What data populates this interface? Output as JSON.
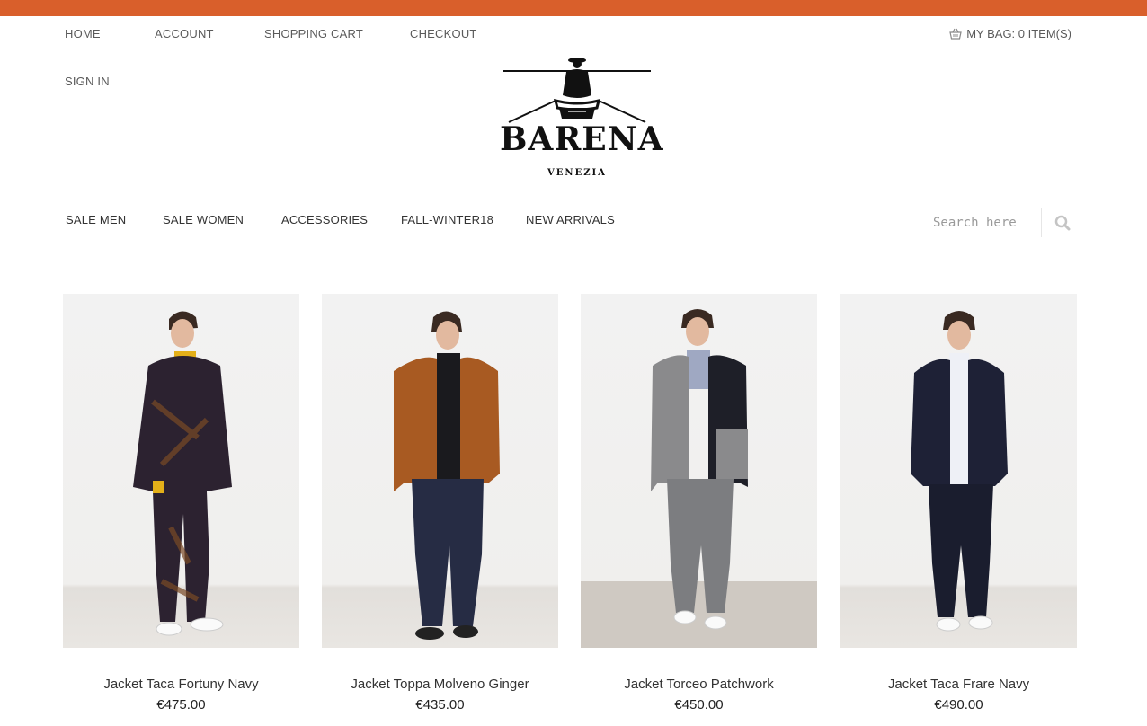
{
  "top_nav": {
    "home": "HOME",
    "account": "ACCOUNT",
    "shopping_cart": "SHOPPING CART",
    "checkout": "CHECKOUT",
    "sign_in": "SIGN IN",
    "bag": "MY BAG: 0 ITEM(S)"
  },
  "logo": {
    "word": "BARENA",
    "sub": "VENEZIA"
  },
  "main_nav": {
    "sale_men": "SALE MEN",
    "sale_women": "SALE WOMEN",
    "accessories": "ACCESSORIES",
    "fall_winter": "FALL-WINTER18",
    "new_arrivals": "NEW ARRIVALS"
  },
  "search": {
    "placeholder": "Search here"
  },
  "products": [
    {
      "name": "Jacket Taca Fortuny Navy",
      "price": "€475.00"
    },
    {
      "name": "Jacket Toppa Molveno Ginger",
      "price": "€435.00"
    },
    {
      "name": "Jacket Torceo Patchwork",
      "price": "€450.00"
    },
    {
      "name": "Jacket Taca Frare Navy",
      "price": "€490.00"
    }
  ],
  "colors": {
    "accent": "#d95f2b"
  }
}
